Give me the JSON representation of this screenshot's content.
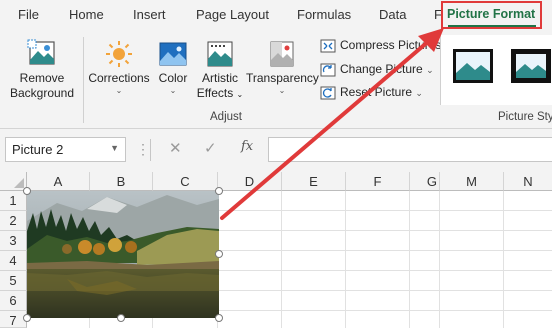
{
  "tabs": {
    "file": "File",
    "home": "Home",
    "insert": "Insert",
    "page_layout": "Page Layout",
    "formulas": "Formulas",
    "data": "Data",
    "partial": "F",
    "picture_format": "Picture Format"
  },
  "ribbon": {
    "remove_background": [
      "Remove",
      "Background"
    ],
    "corrections": "Corrections",
    "color": "Color",
    "artistic_effects": [
      "Artistic",
      "Effects"
    ],
    "transparency": "Transparency",
    "compress_pictures": "Compress Pictures",
    "change_picture": "Change Picture",
    "reset_picture": "Reset Picture",
    "adjust_group": "Adjust",
    "picture_styles_group": "Picture Styles"
  },
  "formula_bar": {
    "name_box": "Picture 2",
    "fx": "fx",
    "value": ""
  },
  "columns": [
    "A",
    "B",
    "C",
    "D",
    "E",
    "F",
    "G",
    "M",
    "N"
  ],
  "rows": [
    "1",
    "2",
    "3",
    "4",
    "5",
    "6",
    "7"
  ],
  "colors": {
    "accent": "#217346",
    "annotation": "#e03a3a"
  }
}
